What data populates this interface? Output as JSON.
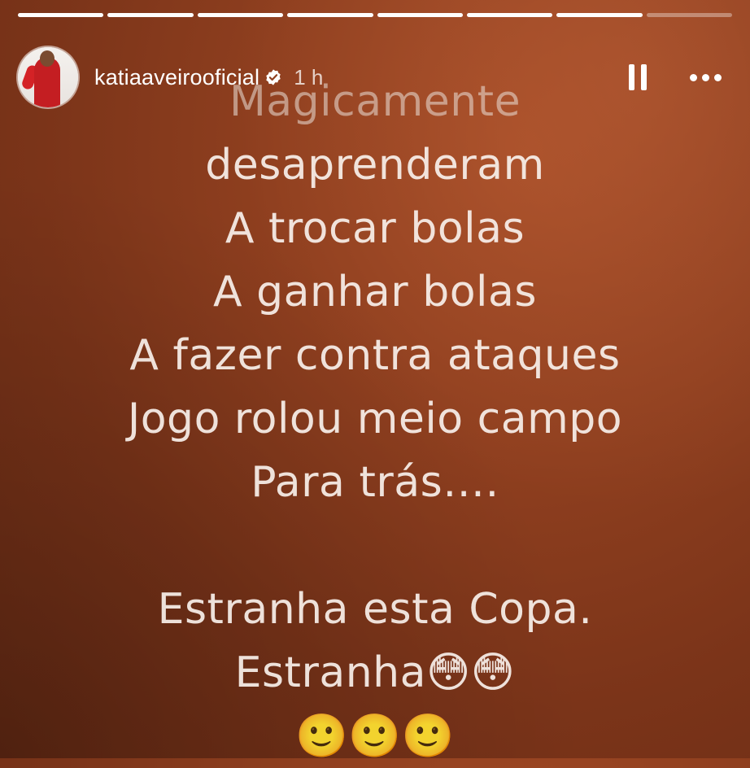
{
  "progress": {
    "segments": 8,
    "completed": 7
  },
  "header": {
    "username": "katiaaveirooficial",
    "verified_icon": "verified-badge-icon",
    "time": "1 h",
    "pause_icon": "pause-icon",
    "more_icon": "more-horizontal-icon"
  },
  "story": {
    "lines": [
      "Magicamente",
      "desaprenderam",
      "A trocar bolas",
      "A ganhar bolas",
      "A fazer contra ataques",
      "Jogo rolou meio campo",
      "Para trás…."
    ],
    "closing_lines": [
      "Estranha esta Copa.",
      "Estranha😳😳",
      "🙂🙂🙂"
    ]
  },
  "colors": {
    "background": "#8f3f1f",
    "text": "#f3e9e2"
  }
}
